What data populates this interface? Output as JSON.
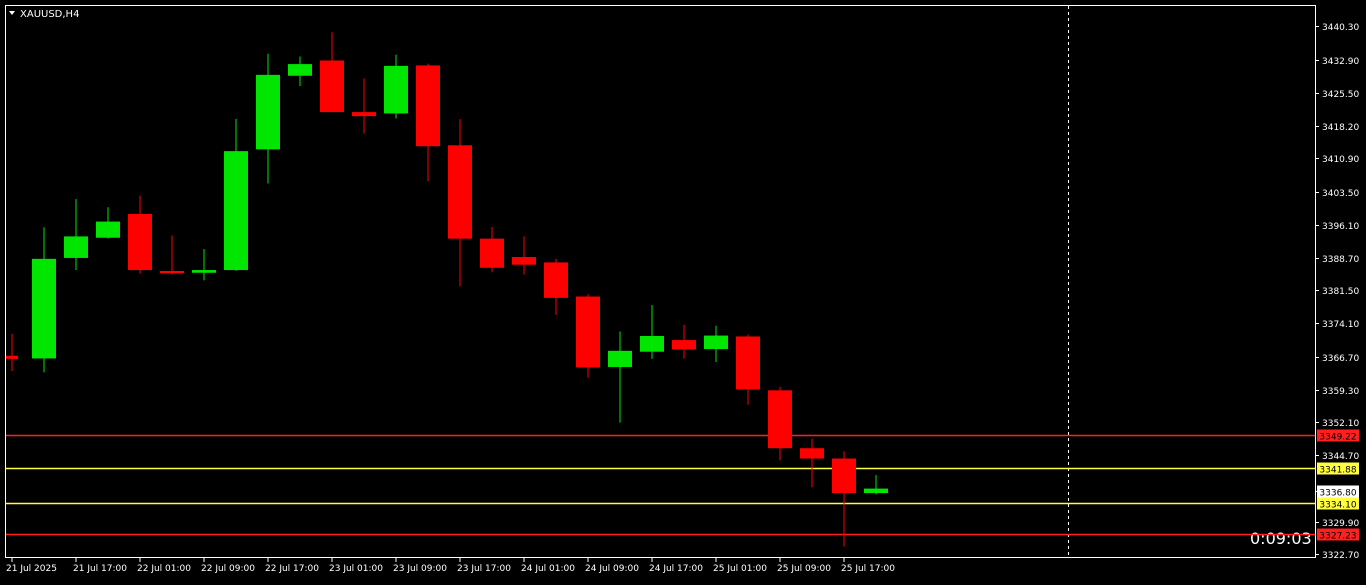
{
  "chart_data": {
    "type": "candlestick",
    "title": "XAUUSD,H4",
    "ylim": [
      3321.0,
      3447.0
    ],
    "y_ticks": [
      3440.3,
      3432.9,
      3425.5,
      3418.2,
      3410.9,
      3403.5,
      3396.1,
      3388.7,
      3381.5,
      3374.1,
      3366.7,
      3359.3,
      3352.1,
      3344.7,
      3336.8,
      3329.9,
      3322.7
    ],
    "y_tick_labels": [
      "3440.30",
      "3432.90",
      "3425.50",
      "3418.20",
      "3410.90",
      "3403.50",
      "3396.10",
      "3388.70",
      "3381.50",
      "3374.10",
      "3366.70",
      "3359.30",
      "3352.10",
      "3344.70",
      "3336.80",
      "3329.90",
      "3322.70"
    ],
    "x_labels": [
      {
        "index": 0,
        "text": "21 Jul 2025"
      },
      {
        "index": 2,
        "text": "21 Jul 17:00"
      },
      {
        "index": 4,
        "text": "22 Jul 01:00"
      },
      {
        "index": 6,
        "text": "22 Jul 09:00"
      },
      {
        "index": 8,
        "text": "22 Jul 17:00"
      },
      {
        "index": 10,
        "text": "23 Jul 01:00"
      },
      {
        "index": 12,
        "text": "23 Jul 09:00"
      },
      {
        "index": 14,
        "text": "23 Jul 17:00"
      },
      {
        "index": 16,
        "text": "24 Jul 01:00"
      },
      {
        "index": 18,
        "text": "24 Jul 09:00"
      },
      {
        "index": 20,
        "text": "24 Jul 17:00"
      },
      {
        "index": 22,
        "text": "25 Jul 01:00"
      },
      {
        "index": 24,
        "text": "25 Jul 09:00"
      },
      {
        "index": 26,
        "text": "25 Jul 17:00"
      }
    ],
    "candles": [
      {
        "o": 3366.9,
        "h": 3371.8,
        "l": 3363.5,
        "c": 3366.2
      },
      {
        "o": 3366.3,
        "h": 3395.5,
        "l": 3363.2,
        "c": 3388.5
      },
      {
        "o": 3388.7,
        "h": 3401.8,
        "l": 3386.0,
        "c": 3393.5
      },
      {
        "o": 3393.2,
        "h": 3400.0,
        "l": 3393.0,
        "c": 3396.8
      },
      {
        "o": 3398.5,
        "h": 3402.6,
        "l": 3385.2,
        "c": 3386.0
      },
      {
        "o": 3385.8,
        "h": 3393.7,
        "l": 3385.0,
        "c": 3385.3
      },
      {
        "o": 3385.4,
        "h": 3390.7,
        "l": 3383.7,
        "c": 3386.0
      },
      {
        "o": 3386.0,
        "h": 3419.7,
        "l": 3385.8,
        "c": 3412.5
      },
      {
        "o": 3412.9,
        "h": 3434.2,
        "l": 3405.3,
        "c": 3429.5
      },
      {
        "o": 3429.3,
        "h": 3433.6,
        "l": 3427.0,
        "c": 3431.9
      },
      {
        "o": 3432.7,
        "h": 3439.0,
        "l": 3421.2,
        "c": 3421.2
      },
      {
        "o": 3421.2,
        "h": 3428.7,
        "l": 3416.4,
        "c": 3420.3
      },
      {
        "o": 3420.9,
        "h": 3434.0,
        "l": 3419.8,
        "c": 3431.5
      },
      {
        "o": 3431.6,
        "h": 3432.0,
        "l": 3405.8,
        "c": 3413.6
      },
      {
        "o": 3413.8,
        "h": 3419.6,
        "l": 3382.4,
        "c": 3393.0
      },
      {
        "o": 3393.0,
        "h": 3395.6,
        "l": 3385.5,
        "c": 3386.5
      },
      {
        "o": 3388.9,
        "h": 3393.5,
        "l": 3385.0,
        "c": 3387.2
      },
      {
        "o": 3387.7,
        "h": 3388.5,
        "l": 3376.0,
        "c": 3379.8
      },
      {
        "o": 3380.1,
        "h": 3380.6,
        "l": 3362.0,
        "c": 3364.3
      },
      {
        "o": 3364.4,
        "h": 3372.3,
        "l": 3352.0,
        "c": 3368.0
      },
      {
        "o": 3367.8,
        "h": 3378.2,
        "l": 3366.2,
        "c": 3371.3
      },
      {
        "o": 3370.4,
        "h": 3373.8,
        "l": 3366.3,
        "c": 3368.3
      },
      {
        "o": 3368.4,
        "h": 3373.6,
        "l": 3365.5,
        "c": 3371.4
      },
      {
        "o": 3371.2,
        "h": 3371.6,
        "l": 3356.0,
        "c": 3359.4
      },
      {
        "o": 3359.2,
        "h": 3360.0,
        "l": 3343.6,
        "c": 3346.3
      },
      {
        "o": 3346.3,
        "h": 3348.4,
        "l": 3337.6,
        "c": 3344.0
      },
      {
        "o": 3344.0,
        "h": 3345.6,
        "l": 3324.4,
        "c": 3336.3
      },
      {
        "o": 3336.3,
        "h": 3340.3,
        "l": 3336.0,
        "c": 3337.3
      }
    ],
    "hlines": [
      {
        "value": 3349.22,
        "color": "#ff2020",
        "label": "3349.22"
      },
      {
        "value": 3341.88,
        "color": "#ffff40",
        "label": "3341.88"
      },
      {
        "value": 3334.1,
        "color": "#ffff40",
        "label": "3334.10"
      },
      {
        "value": 3327.23,
        "color": "#ff2020",
        "label": "3327.23"
      }
    ],
    "current_price": {
      "value": 3336.8,
      "label": "3336.80"
    },
    "period_separator_index": 33,
    "timer": "0:09:03",
    "colors": {
      "background": "#000000",
      "bull": "#00e600",
      "bear": "#ff0000",
      "axis": "#ffffff",
      "grid_text": "#ffffff",
      "separator": "#ffffff"
    }
  }
}
